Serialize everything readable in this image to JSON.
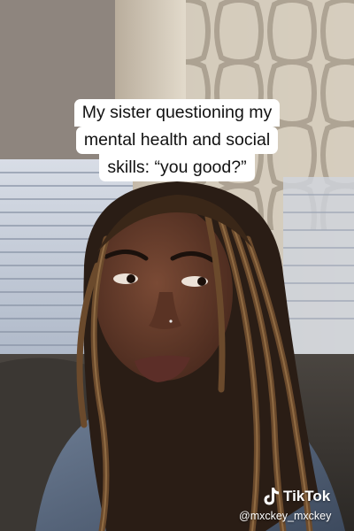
{
  "caption": {
    "lines": [
      "My sister questioning my",
      "mental health and social",
      "skills: “you good?”"
    ]
  },
  "watermark": {
    "brand": "TikTok",
    "handle": "@mxckey_mxckey",
    "icon": "tiktok-note-icon"
  },
  "colors": {
    "caption_bg": "#ffffff",
    "caption_text": "#111111",
    "watermark_text": "#ffffff"
  }
}
